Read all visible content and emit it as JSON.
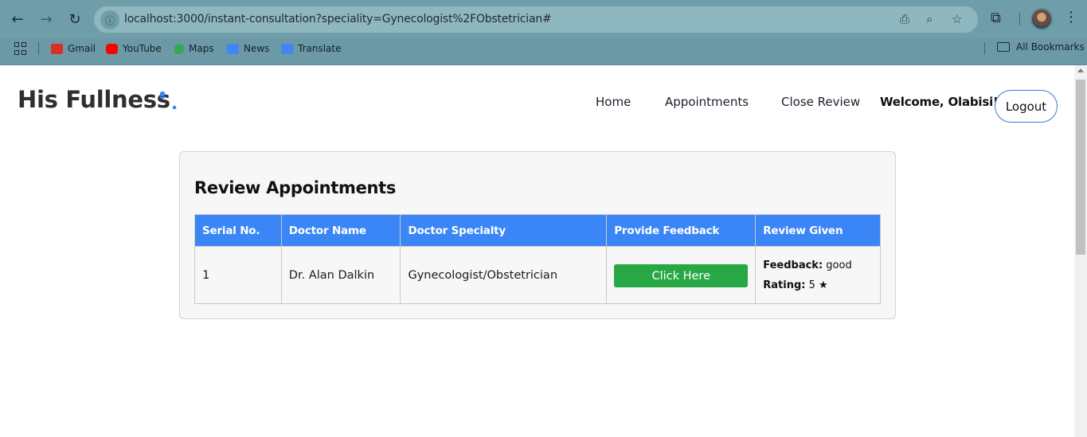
{
  "browser": {
    "url": "localhost:3000/instant-consultation?speciality=Gynecologist%2FObstetrician#",
    "bookmarks": [
      {
        "label": "Gmail",
        "color": "#d93025"
      },
      {
        "label": "YouTube",
        "color": "#ff0000"
      },
      {
        "label": "Maps",
        "color": "#34a853"
      },
      {
        "label": "News",
        "color": "#4285f4"
      },
      {
        "label": "Translate",
        "color": "#4285f4"
      }
    ],
    "all_bookmarks": "All Bookmarks"
  },
  "header": {
    "brand": "His Fullness",
    "nav": [
      "Home",
      "Appointments",
      "Close Review"
    ],
    "welcome": "Welcome, Olabisi!",
    "logout": "Logout"
  },
  "review": {
    "title": "Review Appointments",
    "columns": [
      "Serial No.",
      "Doctor Name",
      "Doctor Specialty",
      "Provide Feedback",
      "Review Given"
    ],
    "rows": [
      {
        "serial": "1",
        "doctor": "Dr. Alan Dalkin",
        "specialty": "Gynecologist/Obstetrician",
        "action": "Click Here",
        "feedback_label": "Feedback:",
        "feedback": "good",
        "rating_label": "Rating:",
        "rating": "5 ★"
      }
    ]
  },
  "colors": {
    "accent": "#3b86f7",
    "button": "#28a745"
  }
}
